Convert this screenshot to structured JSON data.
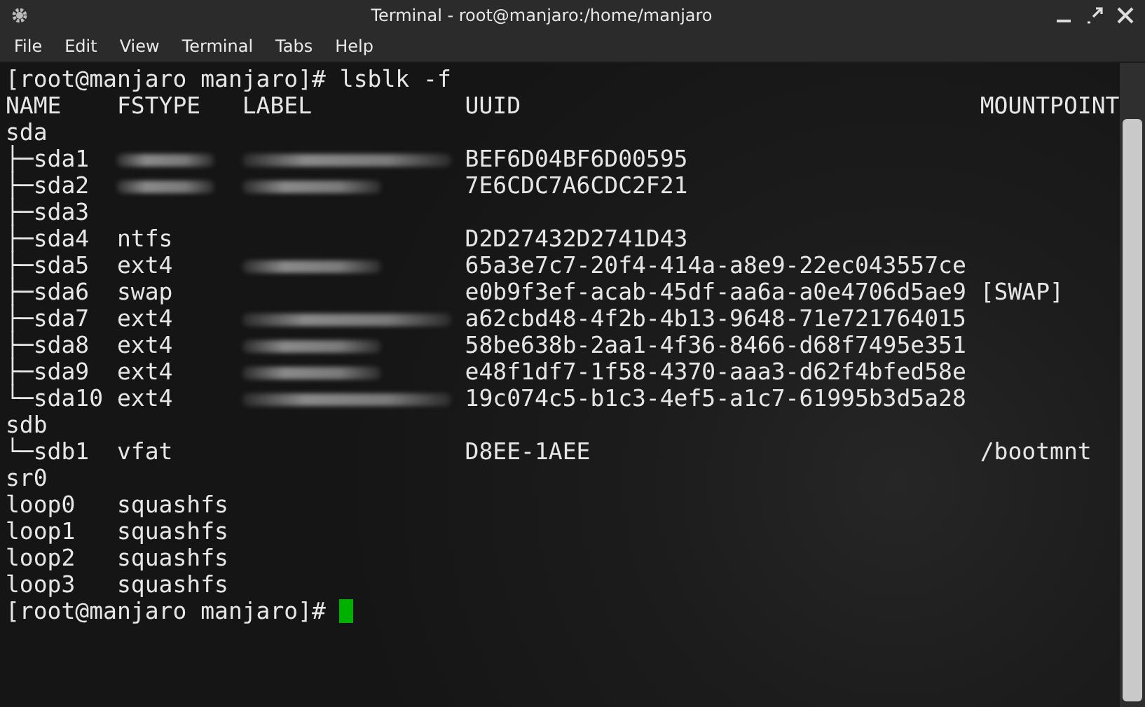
{
  "window": {
    "title": "Terminal - root@manjaro:/home/manjaro"
  },
  "menu": [
    "File",
    "Edit",
    "View",
    "Terminal",
    "Tabs",
    "Help"
  ],
  "terminal": {
    "command_line": "[root@manjaro manjaro]# lsblk -f",
    "columns": [
      "NAME",
      "FSTYPE",
      "LABEL",
      "UUID",
      "MOUNTPOINT"
    ],
    "rows": [
      {
        "name": "sda",
        "fstype": "",
        "fstype_blurred": false,
        "label_blurred": false,
        "uuid": "",
        "mountpoint": ""
      },
      {
        "name": "├─sda1",
        "fstype": "",
        "fstype_blurred": true,
        "label_blurred": true,
        "uuid": "BEF6D04BF6D00595",
        "mountpoint": ""
      },
      {
        "name": "├─sda2",
        "fstype": "",
        "fstype_blurred": true,
        "label_blurred": true,
        "uuid": "7E6CDC7A6CDC2F21",
        "mountpoint": ""
      },
      {
        "name": "├─sda3",
        "fstype": "",
        "fstype_blurred": false,
        "label_blurred": false,
        "uuid": "",
        "mountpoint": ""
      },
      {
        "name": "├─sda4",
        "fstype": "ntfs",
        "fstype_blurred": false,
        "label_blurred": false,
        "uuid": "D2D27432D2741D43",
        "mountpoint": ""
      },
      {
        "name": "├─sda5",
        "fstype": "ext4",
        "fstype_blurred": false,
        "label_blurred": true,
        "uuid": "65a3e7c7-20f4-414a-a8e9-22ec043557ce",
        "mountpoint": ""
      },
      {
        "name": "├─sda6",
        "fstype": "swap",
        "fstype_blurred": false,
        "label_blurred": false,
        "uuid": "e0b9f3ef-acab-45df-aa6a-a0e4706d5ae9",
        "mountpoint": "[SWAP]"
      },
      {
        "name": "├─sda7",
        "fstype": "ext4",
        "fstype_blurred": false,
        "label_blurred": true,
        "uuid": "a62cbd48-4f2b-4b13-9648-71e721764015",
        "mountpoint": ""
      },
      {
        "name": "├─sda8",
        "fstype": "ext4",
        "fstype_blurred": false,
        "label_blurred": true,
        "uuid": "58be638b-2aa1-4f36-8466-d68f7495e351",
        "mountpoint": ""
      },
      {
        "name": "├─sda9",
        "fstype": "ext4",
        "fstype_blurred": false,
        "label_blurred": true,
        "uuid": "e48f1df7-1f58-4370-aaa3-d62f4bfed58e",
        "mountpoint": ""
      },
      {
        "name": "└─sda10",
        "fstype": "ext4",
        "fstype_blurred": false,
        "label_blurred": true,
        "uuid": "19c074c5-b1c3-4ef5-a1c7-61995b3d5a28",
        "mountpoint": ""
      },
      {
        "name": "sdb",
        "fstype": "",
        "fstype_blurred": false,
        "label_blurred": false,
        "uuid": "",
        "mountpoint": ""
      },
      {
        "name": "└─sdb1",
        "fstype": "vfat",
        "fstype_blurred": false,
        "label_blurred": false,
        "uuid": "D8EE-1AEE",
        "mountpoint": "/bootmnt"
      },
      {
        "name": "sr0",
        "fstype": "",
        "fstype_blurred": false,
        "label_blurred": false,
        "uuid": "",
        "mountpoint": ""
      },
      {
        "name": "loop0",
        "fstype": "squashfs",
        "fstype_blurred": false,
        "label_blurred": false,
        "uuid": "",
        "mountpoint": ""
      },
      {
        "name": "loop1",
        "fstype": "squashfs",
        "fstype_blurred": false,
        "label_blurred": false,
        "uuid": "",
        "mountpoint": ""
      },
      {
        "name": "loop2",
        "fstype": "squashfs",
        "fstype_blurred": false,
        "label_blurred": false,
        "uuid": "",
        "mountpoint": ""
      },
      {
        "name": "loop3",
        "fstype": "squashfs",
        "fstype_blurred": false,
        "label_blurred": false,
        "uuid": "",
        "mountpoint": ""
      }
    ],
    "prompt": "[root@manjaro manjaro]#"
  }
}
